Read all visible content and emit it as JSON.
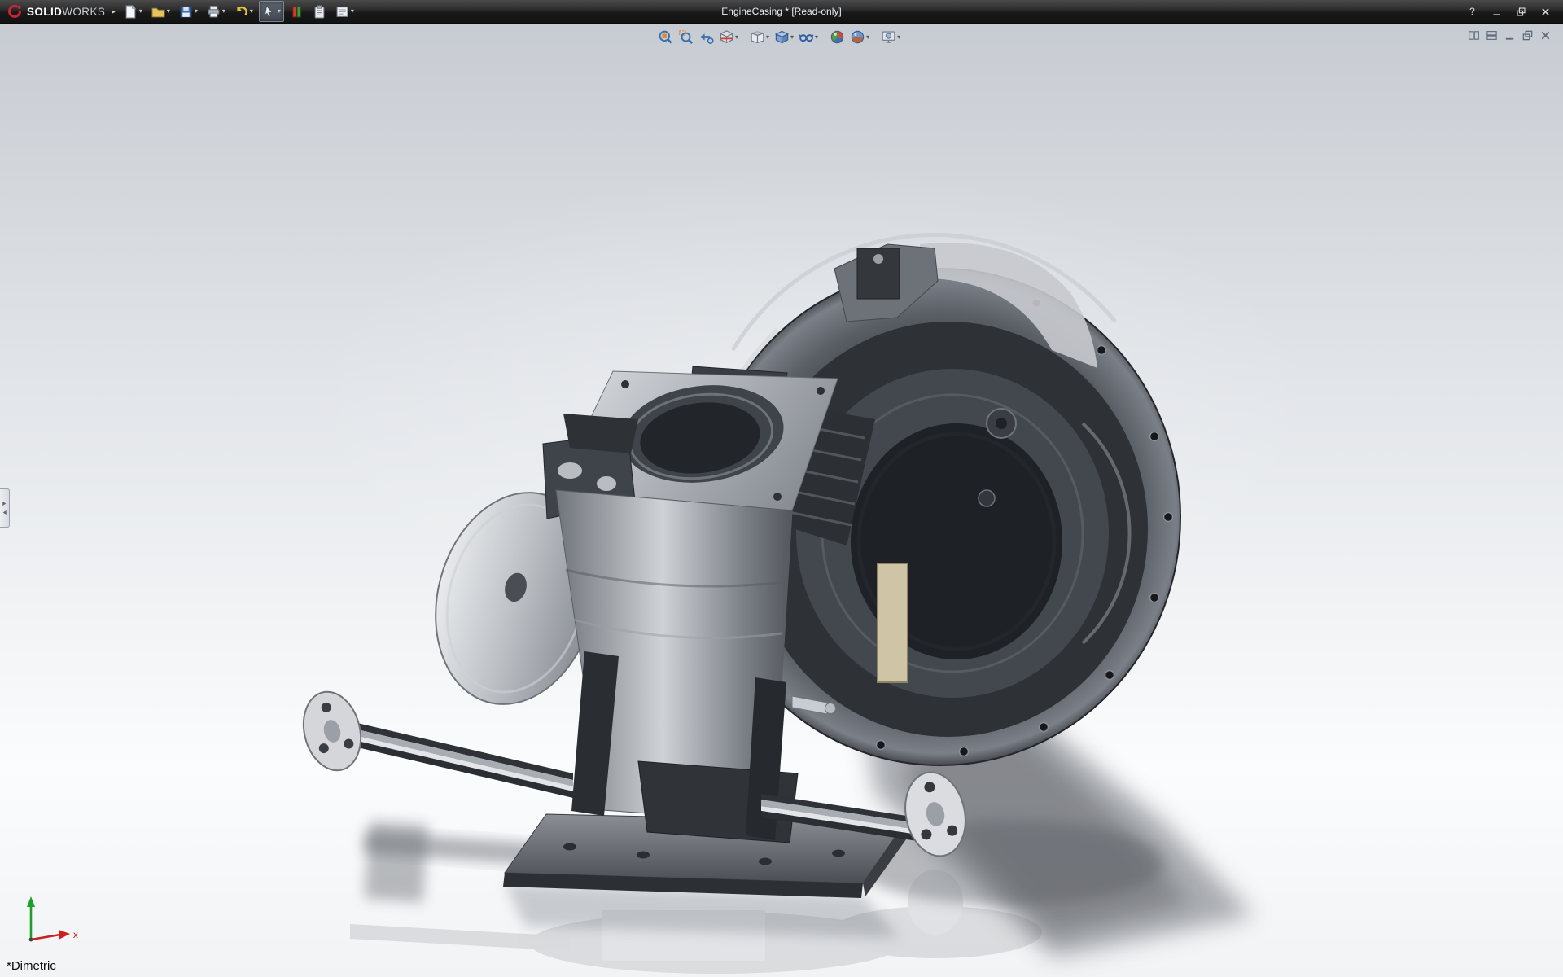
{
  "window": {
    "brand_bold": "SOLID",
    "brand_light": "WORKS",
    "title": "EngineCasing * [Read-only]",
    "help_glyph": "?"
  },
  "ui": {
    "dropdown_glyph": "▾",
    "menu_expand_glyph": "▸"
  },
  "main_toolbar": {
    "buttons": [
      {
        "name": "new-document",
        "dropdown": true
      },
      {
        "name": "open",
        "dropdown": true
      },
      {
        "name": "save",
        "dropdown": true
      },
      {
        "name": "print",
        "dropdown": true
      },
      {
        "name": "undo",
        "dropdown": true
      },
      {
        "name": "select",
        "dropdown": true,
        "active": true
      },
      {
        "name": "rebuild",
        "dropdown": false
      },
      {
        "name": "file-properties",
        "dropdown": false
      },
      {
        "name": "options",
        "dropdown": true
      }
    ]
  },
  "headsup_toolbar": {
    "buttons": [
      {
        "name": "zoom-to-fit",
        "dropdown": false
      },
      {
        "name": "zoom-to-area",
        "dropdown": false
      },
      {
        "name": "previous-view",
        "dropdown": false
      },
      {
        "name": "section-view",
        "dropdown": true
      },
      {
        "name": "view-orientation",
        "dropdown": true
      },
      {
        "name": "display-style",
        "dropdown": true
      },
      {
        "name": "hide-show-items",
        "dropdown": true
      },
      {
        "name": "edit-appearance",
        "dropdown": false
      },
      {
        "name": "apply-scene",
        "dropdown": true
      },
      {
        "name": "view-settings",
        "dropdown": true
      }
    ]
  },
  "doc_controls": {
    "buttons": [
      "doc-pane-split",
      "doc-pane-horizontal",
      "doc-minimize",
      "doc-restore",
      "doc-close"
    ]
  },
  "viewport": {
    "orientation_label": "*Dimetric",
    "triad_x_label": "x",
    "document_type": "3d-part-engine-casing"
  },
  "colors": {
    "titlebar_bg": "#1d1d1f",
    "logo_red": "#cf2030",
    "viewport_top": "#c7cbd2",
    "viewport_bottom": "#f2f3f5",
    "triad_x": "#cc2020",
    "triad_y": "#1e9e2a",
    "model_dark": "#2e3136",
    "model_mid": "#8e939a",
    "model_light": "#d6d9dd"
  }
}
